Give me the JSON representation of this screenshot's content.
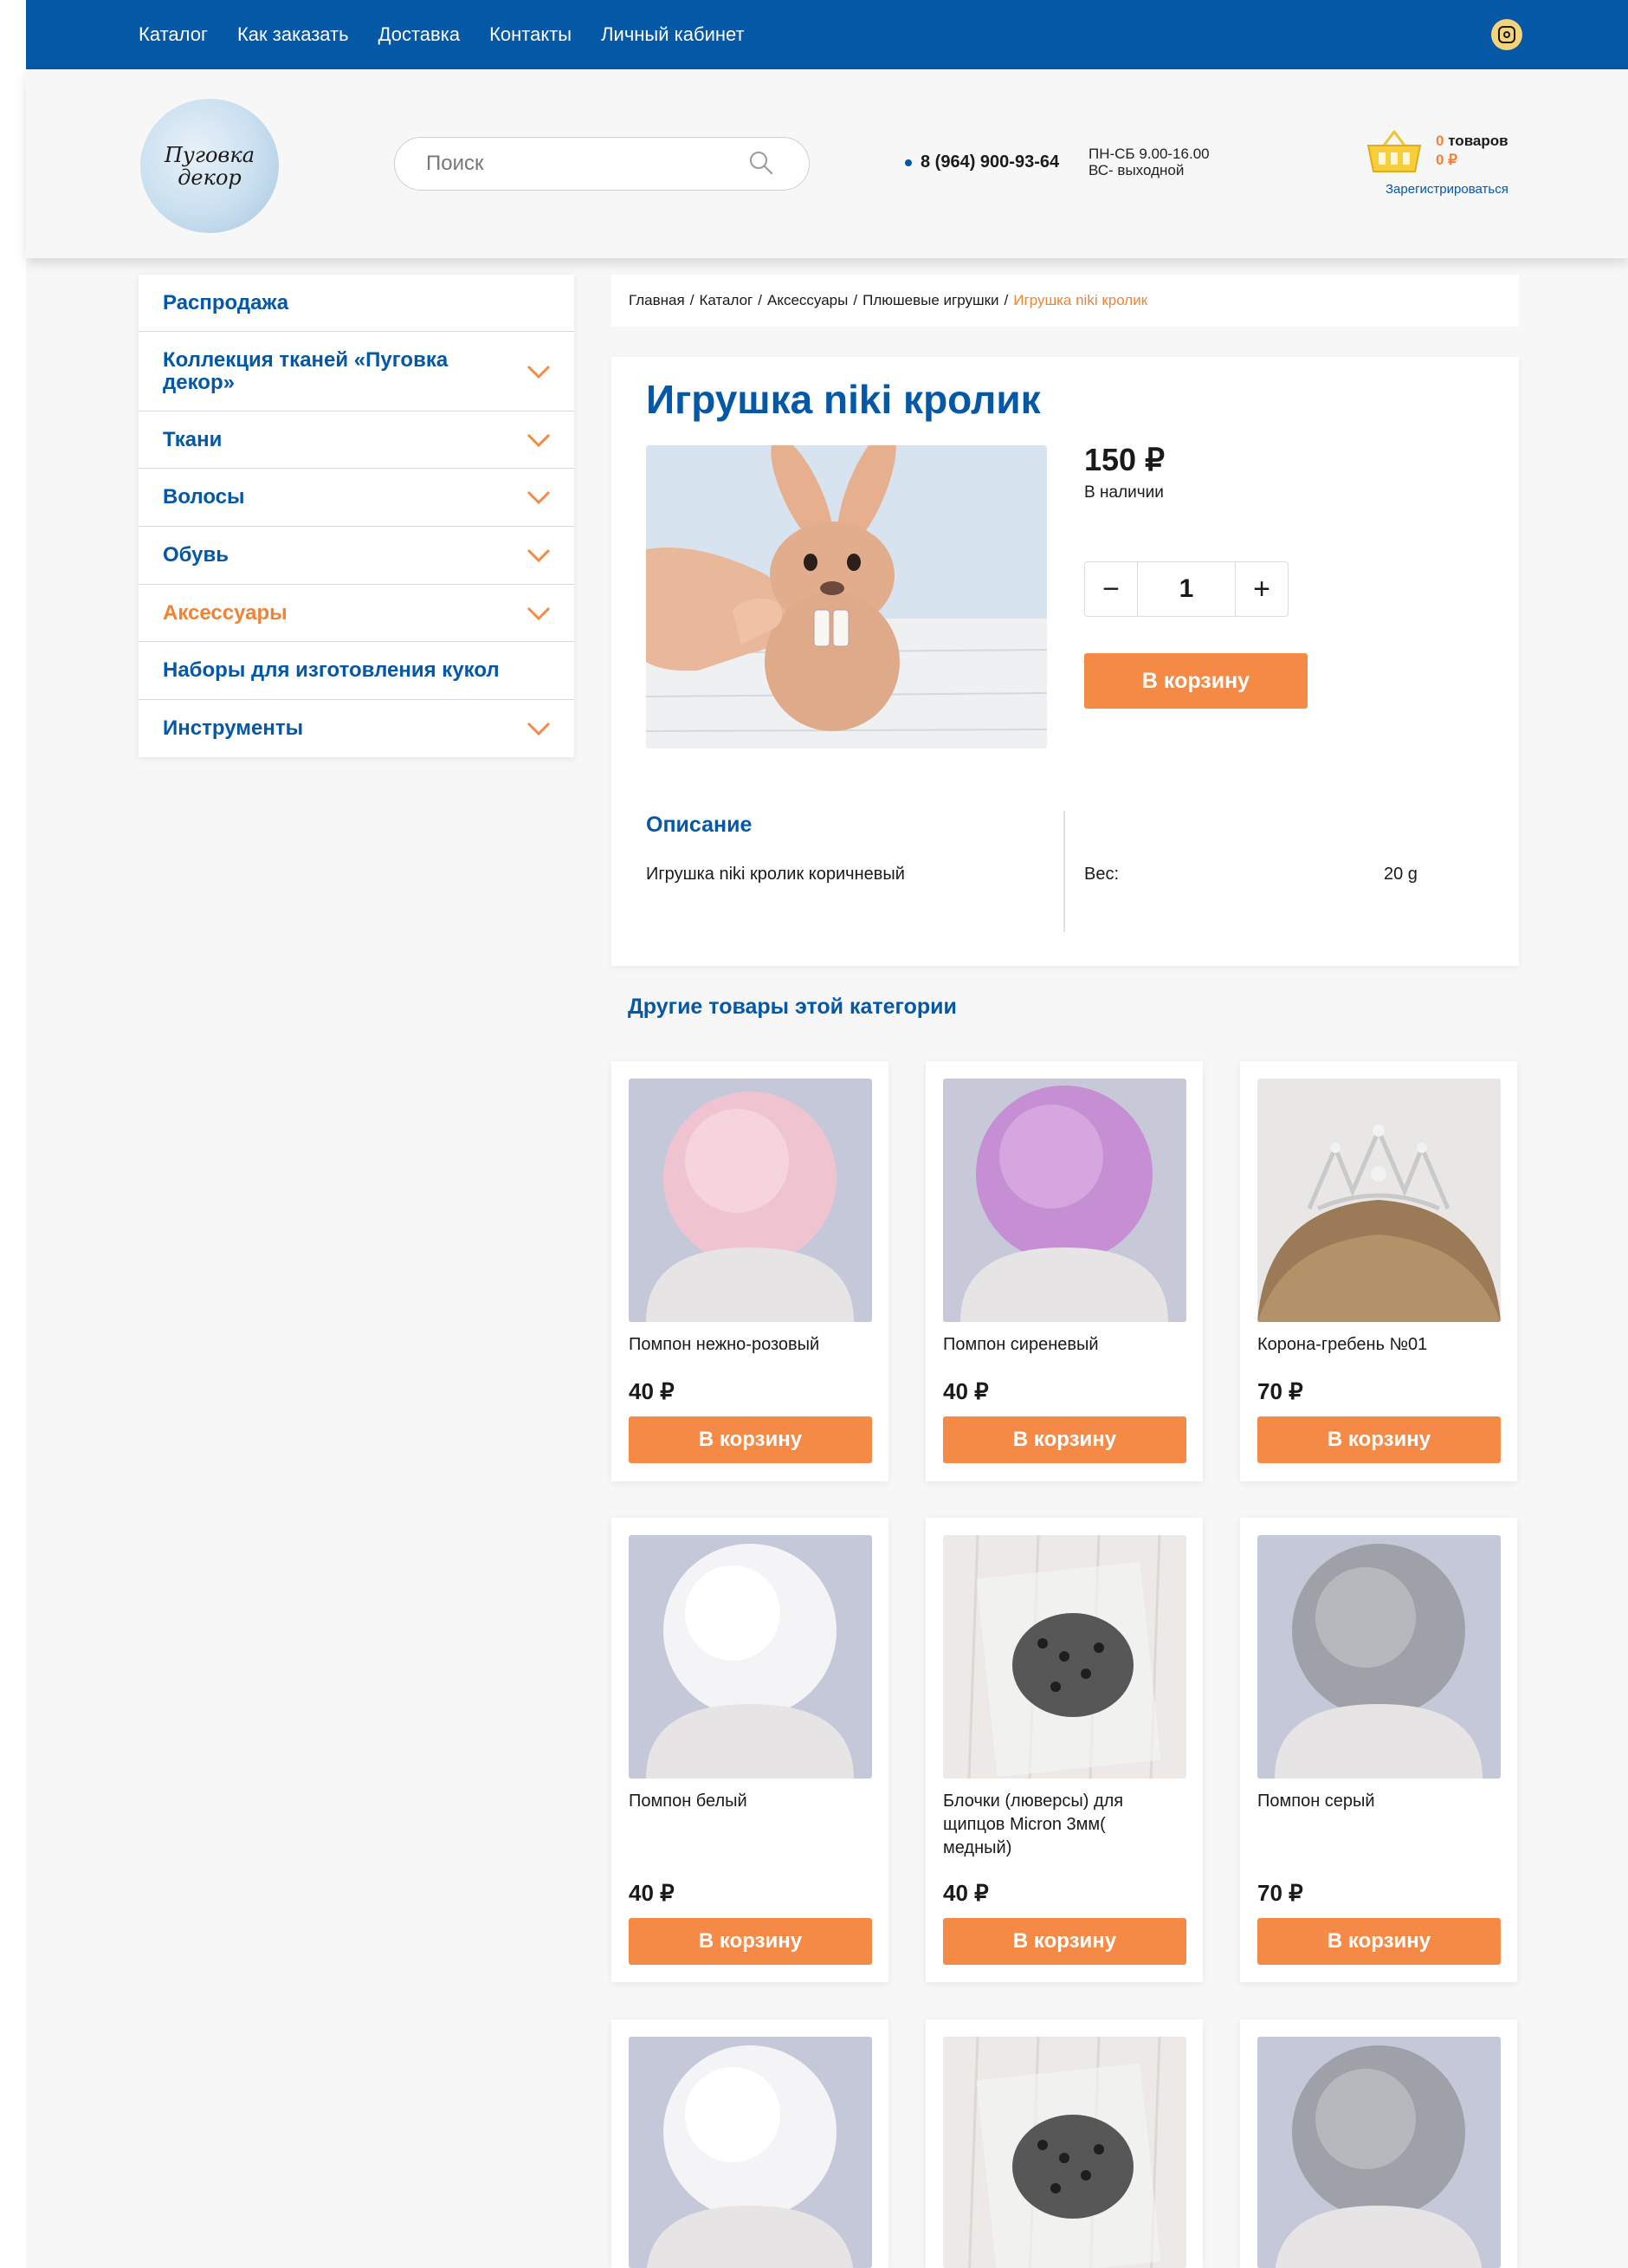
{
  "topnav": {
    "items": [
      "Каталог",
      "Как заказать",
      "Доставка",
      "Контакты",
      "Личный кабинет"
    ],
    "social_icon": "instagram-icon"
  },
  "header": {
    "logo_text_1": "Пуговка",
    "logo_text_2": "декор",
    "search_placeholder": "Поиск",
    "phone": "8 (964) 900-93-64",
    "hours_1": "ПН-СБ 9.00-16.00",
    "hours_2": "ВС- выходной",
    "cart_count": "0",
    "cart_count_word": "товаров",
    "cart_sum": "0 ₽",
    "register": "Зарегистрироваться"
  },
  "sidebar": {
    "items": [
      {
        "label": "Распродажа",
        "has_chevron": false,
        "active": false
      },
      {
        "label": "Коллекция тканей «Пуговка декор»",
        "has_chevron": true,
        "active": false
      },
      {
        "label": "Ткани",
        "has_chevron": true,
        "active": false
      },
      {
        "label": "Волосы",
        "has_chevron": true,
        "active": false
      },
      {
        "label": "Обувь",
        "has_chevron": true,
        "active": false
      },
      {
        "label": "Аксессуары",
        "has_chevron": true,
        "active": true
      },
      {
        "label": "Наборы для изготовления кукол",
        "has_chevron": false,
        "active": false
      },
      {
        "label": "Инструменты",
        "has_chevron": true,
        "active": false
      }
    ]
  },
  "breadcrumb": {
    "items": [
      "Главная",
      "Каталог",
      "Аксессуары",
      "Плюшевые игрушки"
    ],
    "current": "Игрушка niki кролик"
  },
  "product": {
    "title": "Игрушка niki кролик",
    "price": "150 ₽",
    "stock": "В наличии",
    "quantity": "1",
    "minus": "−",
    "plus": "+",
    "buy_label": "В корзину",
    "description_title": "Описание",
    "description": "Игрушка niki кролик коричневый",
    "weight_label": "Вес:",
    "weight_value": "20 g"
  },
  "related": {
    "title": "Другие товары этой категории",
    "buy_label": "В корзину",
    "items": [
      {
        "name": "Помпон нежно-розовый",
        "price": "40 ₽",
        "image": "pink-pompom"
      },
      {
        "name": "Помпон сиреневый",
        "price": "40 ₽",
        "image": "lilac-pompom"
      },
      {
        "name": "Корона-гребень №01",
        "price": "70 ₽",
        "image": "tiara-comb"
      },
      {
        "name": "Помпон белый",
        "price": "40 ₽",
        "image": "white-pompom"
      },
      {
        "name": "Блочки (люверсы) для щипцов Micron 3мм( медный)",
        "price": "40 ₽",
        "image": "eyelets-bag"
      },
      {
        "name": "Помпон серый",
        "price": "70 ₽",
        "image": "grey-pompom"
      },
      {
        "name": "",
        "price": "",
        "image": "white-pompom"
      },
      {
        "name": "",
        "price": "",
        "image": "eyelets-bag"
      },
      {
        "name": "",
        "price": "",
        "image": "grey-pompom"
      }
    ]
  },
  "colors": {
    "brand_blue": "#0458a6",
    "accent_orange": "#f58a47",
    "active_orange": "#f08336"
  }
}
